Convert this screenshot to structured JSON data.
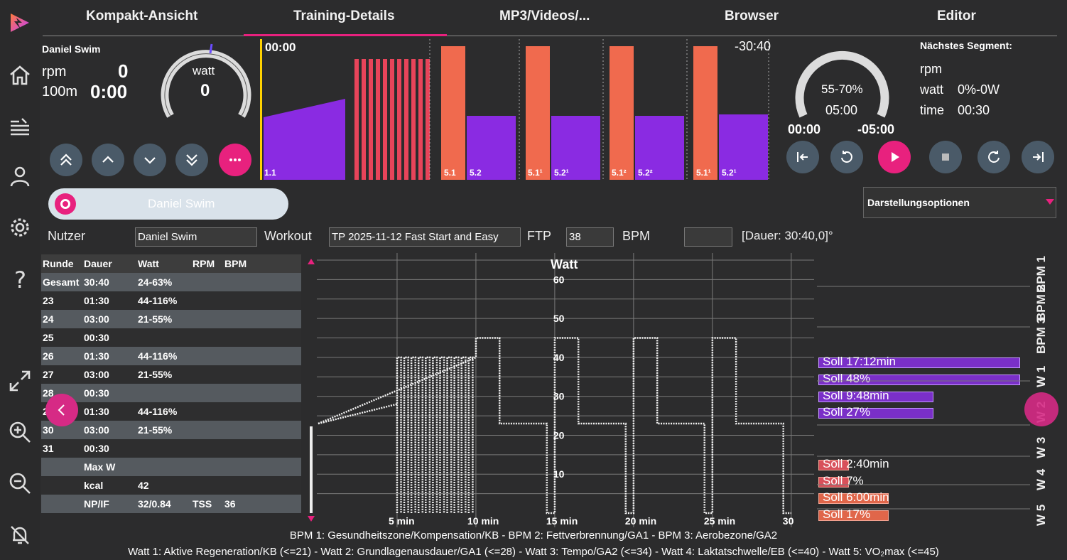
{
  "tabs": [
    "Kompakt-Ansicht",
    "Training-Details",
    "MP3/Videos/...",
    "Browser",
    "Editor"
  ],
  "rider": {
    "name": "Daniel Swim",
    "rpm_label": "rpm",
    "rpm_value": "0",
    "dist_label": "100m",
    "time_value": "0:00",
    "gauge_label": "watt",
    "gauge_value": "0"
  },
  "profile": {
    "elapsed": "00:00",
    "remaining": "-30:40",
    "bars": [
      {
        "label": "1.1"
      },
      {
        "label": "5.1"
      },
      {
        "label": "5.2"
      },
      {
        "label": "5.1¹"
      },
      {
        "label": "5.2¹"
      },
      {
        "label": "5.1²"
      },
      {
        "label": "5.2²"
      },
      {
        "label": "5.1¹"
      },
      {
        "label": "5.2¹"
      }
    ]
  },
  "segment": {
    "gauge_pct": "55-70%",
    "gauge_time": "05:00",
    "elapsed": "00:00",
    "remaining": "-05:00",
    "next_title": "Nächstes Segment:",
    "next_rpm_label": "rpm",
    "next_watt_label": "watt",
    "next_watt_value": "0%-0W",
    "next_time_label": "time",
    "next_time_value": "00:30"
  },
  "user_toggle": "Daniel Swim",
  "display_options": "Darstellungsoptionen",
  "form": {
    "user_label": "Nutzer",
    "user_value": "Daniel Swim",
    "workout_label": "Workout",
    "workout_value": "TP 2025-11-12 Fast Start and Easy",
    "ftp_label": "FTP",
    "ftp_value": "38",
    "bpm_label": "BPM",
    "bpm_value": "",
    "duration": "[Dauer: 30:40,0]°"
  },
  "table": {
    "headers": [
      "Runde",
      "Dauer",
      "Watt",
      "RPM",
      "BPM"
    ],
    "rows": [
      [
        "Gesamt",
        "30:40",
        "24-63%",
        "",
        ""
      ],
      [
        "23",
        "01:30",
        "44-116%",
        "",
        ""
      ],
      [
        "24",
        "03:00",
        "21-55%",
        "",
        ""
      ],
      [
        "25",
        "00:30",
        "",
        "",
        ""
      ],
      [
        "26",
        "01:30",
        "44-116%",
        "",
        ""
      ],
      [
        "27",
        "03:00",
        "21-55%",
        "",
        ""
      ],
      [
        "28",
        "00:30",
        "",
        "",
        ""
      ],
      [
        "29",
        "01:30",
        "44-116%",
        "",
        ""
      ],
      [
        "30",
        "03:00",
        "21-55%",
        "",
        ""
      ],
      [
        "31",
        "00:30",
        "",
        "",
        ""
      ],
      [
        "",
        "Max W",
        "",
        "",
        ""
      ],
      [
        "",
        "kcal",
        "42",
        "",
        ""
      ],
      [
        "",
        "NP/IF",
        "32/0.84",
        "TSS",
        "36"
      ]
    ]
  },
  "chart_data": {
    "type": "line",
    "title": "Watt",
    "x_ticks": [
      "5 min",
      "10 min",
      "15 min",
      "20 min",
      "25 min",
      "30"
    ],
    "y_ticks": [
      "10",
      "20",
      "30",
      "40",
      "50",
      "60"
    ],
    "xlim": [
      0,
      31
    ],
    "ylim": [
      0,
      65
    ],
    "grid": true,
    "series": [
      {
        "x": [
          0,
          5,
          5,
          10,
          10,
          11.5,
          11.5,
          14.5,
          14.5,
          15,
          15,
          16.5,
          16.5,
          19.5,
          19.5,
          20,
          20,
          21.5,
          21.5,
          24.5,
          24.5,
          25,
          25,
          26.5,
          26.5,
          29.5,
          29.5,
          30,
          30
        ],
        "y": [
          23,
          28,
          40,
          40,
          45,
          45,
          23,
          23,
          0,
          0,
          45,
          45,
          23,
          23,
          0,
          0,
          45,
          45,
          23,
          23,
          0,
          0,
          45,
          45,
          23,
          23,
          0,
          0,
          0
        ]
      }
    ],
    "intervals_note": "",
    "zones": [
      {
        "label": "Soll 17:12min",
        "color": "#7a2fc8",
        "fill": 1.0
      },
      {
        "label": "Soll 48%",
        "color": "#7a2fc8",
        "fill": 1.0
      },
      {
        "label": "Soll 9:48min",
        "color": "#7a2fc8",
        "fill": 0.57
      },
      {
        "label": "Soll 27%",
        "color": "#7a2fc8",
        "fill": 0.57
      },
      {
        "label": "Soll 2:40min",
        "color": "#d8505a",
        "fill": 0.15
      },
      {
        "label": "Soll 7%",
        "color": "#d8505a",
        "fill": 0.15
      },
      {
        "label": "Soll 6:00min",
        "color": "#e0664a",
        "fill": 0.35
      },
      {
        "label": "Soll 17%",
        "color": "#e0664a",
        "fill": 0.35
      }
    ],
    "zone_axis": [
      "BPM 1",
      "BPM 2",
      "BPM 3",
      "W 1",
      "W 2",
      "W 3",
      "W 4",
      "W 5"
    ]
  },
  "legend": {
    "bpm": "BPM 1: Gesundheitszone/Kompensation/KB - BPM 2: Fettverbrennung/GA1 - BPM 3: Aerobezone/GA2",
    "watt": "Watt 1: Aktive Regeneration/KB (<=21) - Watt 2: Grundlagenausdauer/GA1 (<=28) - Watt 3: Tempo/GA2 (<=34) - Watt 4: Laktatschwelle/EB (<=40) - Watt 5: VO₂max (<=45)"
  },
  "colors": {
    "accent": "#e8217e",
    "purple": "#7a2fc8",
    "orange": "#f06a4e",
    "button": "#4a5a68"
  }
}
